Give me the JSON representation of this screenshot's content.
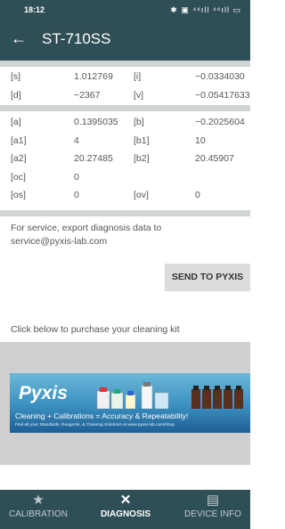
{
  "status": {
    "time": "18:12",
    "icons": "✱ ▣ ⁴⁶ıll ⁴⁶ıll ▭"
  },
  "appbar": {
    "back_icon": "←",
    "title": "ST-710SS"
  },
  "readings": {
    "group1": [
      {
        "k1": "[s]",
        "v1": "1.012769",
        "k2": "[i]",
        "v2": "−0.0334030"
      },
      {
        "k1": "[d]",
        "v1": "−2367",
        "k2": "[v]",
        "v2": "−0.05417633"
      }
    ],
    "group2": [
      {
        "k1": "[a]",
        "v1": "0.1395035",
        "k2": "[b]",
        "v2": "−0.2025604"
      },
      {
        "k1": "[a1]",
        "v1": "4",
        "k2": "[b1]",
        "v2": "10"
      },
      {
        "k1": "[a2]",
        "v1": "20.27485",
        "k2": "[b2]",
        "v2": "20.45907"
      },
      {
        "k1": "[oc]",
        "v1": "0",
        "k2": "",
        "v2": ""
      },
      {
        "k1": "[os]",
        "v1": "0",
        "k2": "[ov]",
        "v2": "0"
      }
    ]
  },
  "service": {
    "note": "For service, export diagnosis data to service@pyxis-lab.com",
    "send_label": "SEND TO PYXIS"
  },
  "purchase": {
    "label": "Click below to purchase your cleaning kit",
    "banner_brand": "Pyxis",
    "banner_tagline": "Cleaning + Calibrations = Accuracy & Repeatability!",
    "banner_fineprint": "Find all your Standards, Reagents, & Cleaning Solutions at www.pyxis-lab.com/shop"
  },
  "nav": [
    {
      "icon": "★",
      "label": "CALIBRATION",
      "active": false
    },
    {
      "icon": "✕",
      "label": "DIAGNOSIS",
      "active": true
    },
    {
      "icon": "▤",
      "label": "DEVICE INFO",
      "active": false
    }
  ],
  "colors": {
    "bar": "#2f4f57",
    "separator": "#cfd4d5",
    "button": "#dcdcdc"
  }
}
